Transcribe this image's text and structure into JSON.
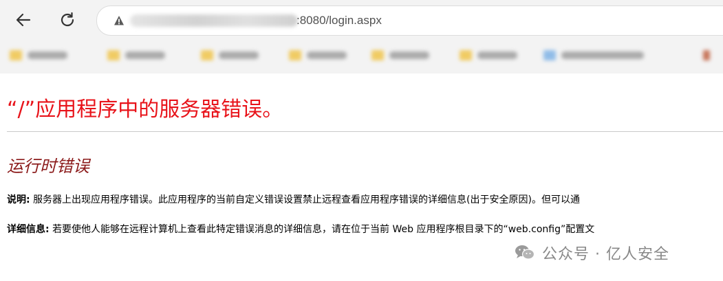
{
  "browser": {
    "url_visible": ":8080/login.aspx"
  },
  "icons": {
    "back": "back-arrow-icon",
    "reload": "reload-icon",
    "security": "not-secure-warning-icon",
    "wechat": "wechat-icon"
  },
  "error_page": {
    "title": "“/”应用程序中的服务器错误。",
    "subtitle": "运行时错误",
    "description_label": "说明:",
    "description_text": "服务器上出现应用程序错误。此应用程序的当前自定义错误设置禁止远程查看应用程序错误的详细信息(出于安全原因)。但可以通",
    "details_label": "详细信息:",
    "details_text": "若要使他人能够在远程计算机上查看此特定错误消息的详细信息，请在位于当前 Web 应用程序根目录下的“web.config”配置文"
  },
  "watermark": {
    "text": "公众号 · 亿人安全"
  },
  "colors": {
    "title_red": "#e8131a",
    "subtitle_maroon": "#8b1a1a",
    "chrome_bg": "#f3f3f3"
  }
}
